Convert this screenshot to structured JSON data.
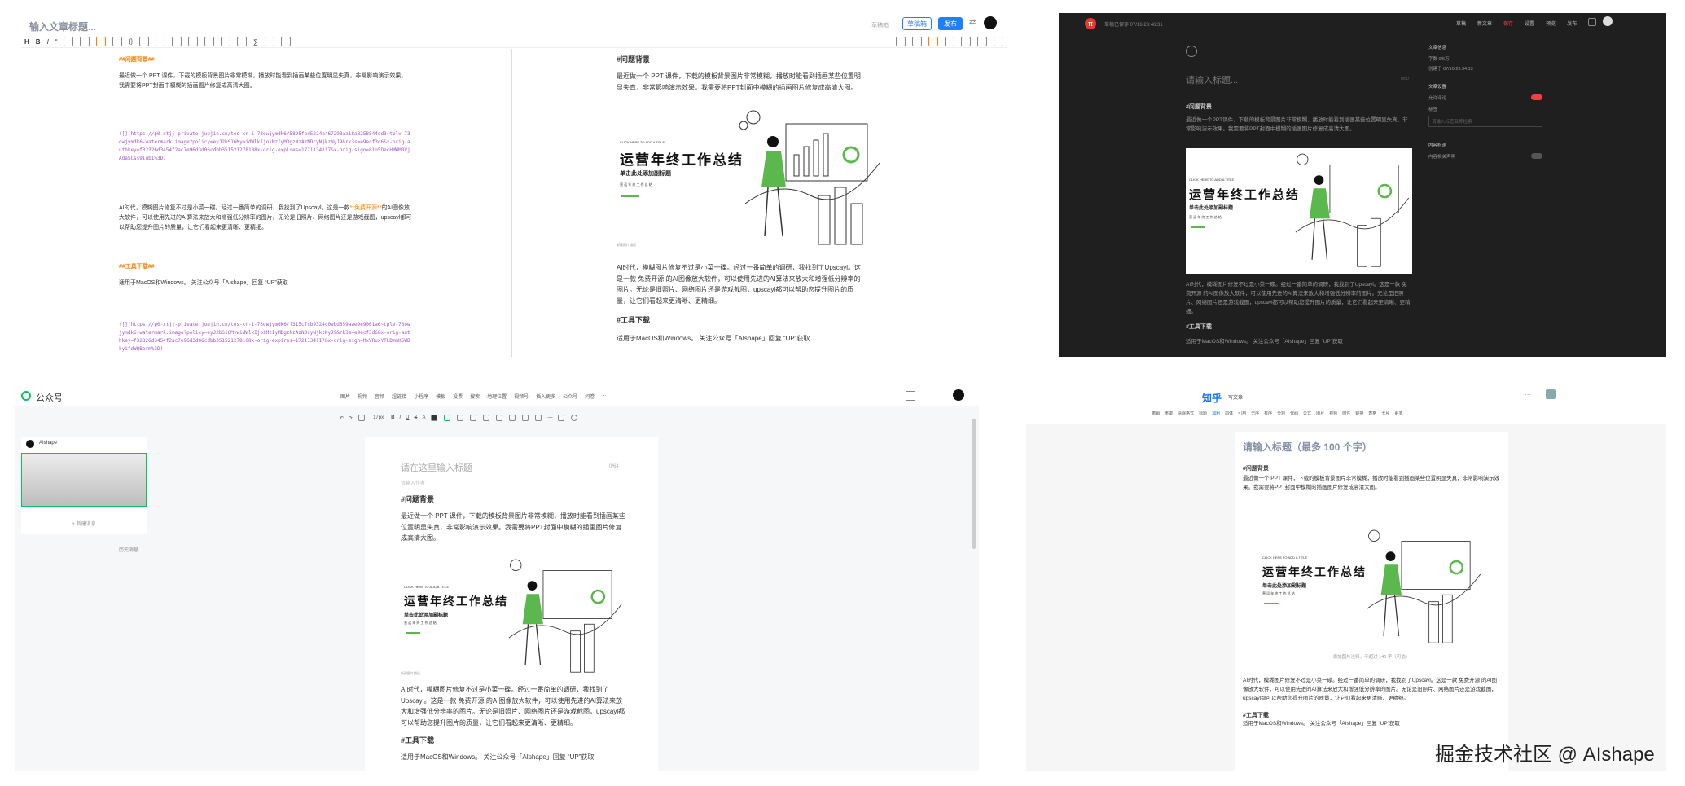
{
  "colors": {
    "brand_blue": "#1e80ff",
    "accent_orange": "#ff7d00",
    "md_link": "#a54fd5",
    "dark_bg": "#1f1f1f",
    "toggle_red": "#f53f3f",
    "figure_green": "#5bb84c"
  },
  "juejin": {
    "title_placeholder": "输入文章标题...",
    "header_hint": "草稿箱",
    "draft_button": "草稿箱",
    "publish_button": "发布",
    "toolbar_left": [
      "H",
      "B",
      "I",
      "“",
      "link",
      "image",
      "code",
      "{}",
      "list",
      "ol",
      "strike",
      "table",
      "img2",
      "tri",
      "∑",
      "grid",
      "lock"
    ],
    "editor": {
      "h1": "##问题背景##",
      "p1": "最近做一个 PPT 课件，下载的模板背景图片非常模糊，播放时能看到插画某些位置明显失真，非常影响演示效果。我需要将PPT封面中模糊的插画图片修复成高清大图。",
      "img1": "![](https://p0-xtjj-private.juejin.cn/tos-cn-i-73owjymdk6/5895fed5224a467298aa18a8258844ed3~tplv-73owjymdk6-watermark.image?policy=eyJ2bS16MywidWlkIjoiMzIyMDgzNzAzNDcyNjkzNyJ9&rk3s=e9ecf3d6&x-orig-authkey=f32326d3454f2ac7e96d3d06cdbb351521278108x-orig-expires=1721134117&x-orig-sign=81o5DecHMWMRVjAdaSCss9iub1%3D)",
      "p2a": "AI时代，模糊图片修复不过是小菜一碟。经过一番简单的调研，我找到了Upscayl。这是一款",
      "p2b": "**免费开源**",
      "p2c": "的AI图像放大软件，可以使用先进的AI算法来放大和增强低分辨率的图片。无论是旧照片、网络图片还是游戏截图，upscayl都可以帮助您提升图片的质量，让它们看起来更清晰、更精细。",
      "h2": "##工具下载##",
      "p3": "适用于MacOS和Windows。 关注公众号「AIshape」回复 “UP”获取",
      "img2": "![](https://p0-xtjj-private.juejin.cn/tos-cn-i-73owjymdk6/f315cfcb9324c0ebd359aae9e9061a6~tplv-73owjymdk6-watermark.image?policy=eyJ2bS16MywidWlkIjoiMzIyMDgzNzAzNDcyNjkzNyJ9&rk3s=e9ecf3d6&x-orig-authkey=f32326d3454f2ac7e96d3d06cdbb351521278108x-orig-expires=1721134117&x-orig-sign=MxVRuxYTLDmmK5WBkyifdWQBorm%3D)"
    },
    "preview": {
      "h1": "#问题背景",
      "p1": "最近做一个 PPT 课件，下载的模板背景图片非常模糊，播放时能看到插画某些位置明显失真，非常影响演示效果。我需要将PPT封面中模糊的插画图片修复成高清大图。",
      "caption": "新建图片描述",
      "p2": "AI时代，模糊图片修复不过是小菜一碟。经过一番简单的调研，我找到了Upscayl。这是一款 免费开源 的AI图像放大软件，可以使用先进的AI算法来放大和增强低分辨率的图片。无论是旧照片、网络图片还是游戏截图，upscayl都可以帮助您提升图片的质量，让它们看起来更清晰、更精细。",
      "h2": "#工具下载",
      "p3": "适用于MacOS和Windows。 关注公众号「AIshape」回复 “UP”获取"
    }
  },
  "poster": {
    "small": "CLICK HERE TO ADD A TITLE",
    "title": "运营年终工作总结",
    "subtitle": "单击此处添加副标题",
    "tags": "营 运 年 终 工 作 总 结"
  },
  "dark": {
    "nav_label": "草稿已保存 07/16 23:46:31",
    "nav_items": [
      "草稿",
      "新文章",
      "保存",
      "设置",
      "预览",
      "发布"
    ],
    "title_placeholder": "请输入标题...",
    "char_count": "0/50",
    "h1": "#问题背景",
    "p1": "最近做一个PPT课件，下载的模板背景图片非常模糊，播放时能看到插画某些位置明显失真，非常影响演示效果。我需要将PPT封面中模糊的插画图片修复成高清大图。",
    "p2": "AI时代，模糊图片修复不过是小菜一碟。经过一番简单的调研，我找到了Upscayl。这是一款 免费开源 的AI图像放大软件，可以使用先进的AI算法来放大和增强低分辨率的图片。无论是旧照片、网络图片还是游戏截图，upscayl都可以帮助您提升图片的质量，让它们看起来更清晰、更精细。",
    "h2": "#工具下载",
    "p3": "适用于MacOS和Windows。 关注公众号「AIshape」回复 “UP”获取",
    "side": {
      "section1": "文章信息",
      "count": "字数 0/5万",
      "time": "创建于 07/16 23:34:13",
      "section2": "文章设置",
      "comment": "允许评论",
      "tag": "标签",
      "tag_placeholder": "请输入标签名称检索",
      "section3": "内容检测",
      "detect": "内容相关声明"
    }
  },
  "wechat": {
    "brand": "公众号",
    "menu": [
      "图片",
      "视频",
      "音频",
      "超链接",
      "小程序",
      "模板",
      "投票",
      "搜索",
      "地理位置",
      "视频号",
      "插入更多",
      "公众号",
      "问卷",
      "..."
    ],
    "font_size": "17px",
    "account_name": "AIshape",
    "add_article": "+ 新建消息",
    "history": "历史消息",
    "title_placeholder": "请在这里输入标题",
    "title_count": "0/64",
    "author_placeholder": "请输入作者",
    "h1": "#问题背景",
    "p1": "最近做一个 PPT 课件，下载的模板背景图片非常模糊，播放时能看到插画某些位置明显失真，非常影响演示效果。我需要将PPT封面中模糊的插画图片修复成高清大图。",
    "caption": "新建图片描述",
    "p2": "AI时代，模糊图片修复不过是小菜一碟。经过一番简单的调研，我找到了Upscayl。这是一款 免费开源 的AI图像放大软件，可以使用先进的AI算法来放大和增强低分辨率的图片。无论是旧照片、网络图片还是游戏截图，upscayl都可以帮助您提升图片的质量，让它们看起来更清晰、更精细。",
    "h2": "#工具下载",
    "p3": "适用于MacOS和Windows。 关注公众号「AIshape」回复 “UP”获取"
  },
  "zhihu": {
    "brand": "知乎",
    "section": "写文章",
    "tools": [
      "撤销",
      "重做",
      "清除格式",
      "标题",
      "加粗",
      "斜体",
      "引用",
      "无序",
      "有序",
      "分割",
      "代码",
      "公式",
      "图片",
      "视频",
      "附件",
      "链接",
      "表格",
      "卡片",
      "更多"
    ],
    "title_placeholder": "请输入标题（最多 100 个字）",
    "h1": "#问题背景",
    "p1": "最近做一个 PPT 课件，下载的模板背景图片非常模糊，播放时能看到插画某些位置明显失真，非常影响演示效果。我需要将PPT封面中模糊的插画图片修复成高清大图。",
    "caption": "添加图片注释，不超过 140 字（可选）",
    "p2": "AI时代，模糊图片修复不过是小菜一碟。经过一番简单的调研，我找到了Upscayl。这是一款 免费开源 的AI图像放大软件，可以使用先进的AI算法来放大和增强低分辨率的图片。无论是旧照片、网络图片还是游戏截图，upscayl都可以帮助您提升图片的质量，让它们看起来更清晰、更精细。",
    "h2": "#工具下载",
    "p3": "适用于MacOS和Windows。 关注公众号「AIshape」回复 “UP”获取"
  },
  "watermark": "掘金技术社区 @ AIshape"
}
